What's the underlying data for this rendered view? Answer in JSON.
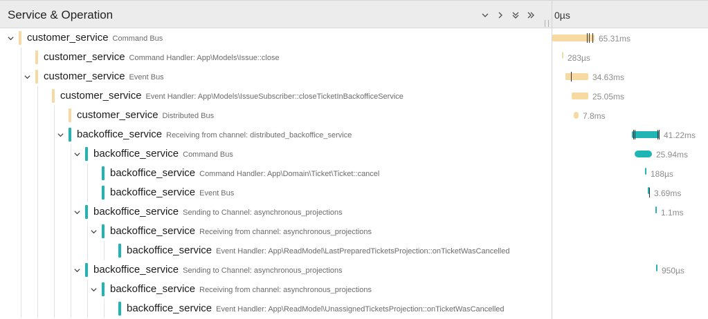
{
  "header": {
    "title": "Service & Operation",
    "timeline_start": "0µs"
  },
  "colors": {
    "customer_service": "#f7d9a2",
    "backoffice_service": "#1fb5b5"
  },
  "rows": [
    {
      "service": "customer_service",
      "operation": "Command Bus",
      "duration": "65.31ms"
    },
    {
      "service": "customer_service",
      "operation": "Command Handler: App\\Models\\Issue::close",
      "duration": "283µs"
    },
    {
      "service": "customer_service",
      "operation": "Event Bus",
      "duration": "34.63ms"
    },
    {
      "service": "customer_service",
      "operation": "Event Handler: App\\Models\\IssueSubscriber::closeTicketInBackofficeService",
      "duration": "25.05ms"
    },
    {
      "service": "customer_service",
      "operation": "Distributed Bus",
      "duration": "7.8ms"
    },
    {
      "service": "backoffice_service",
      "operation": "Receiving from channel: distributed_backoffice_service",
      "duration": "41.22ms"
    },
    {
      "service": "backoffice_service",
      "operation": "Command Bus",
      "duration": "25.94ms"
    },
    {
      "service": "backoffice_service",
      "operation": "Command Handler: App\\Domain\\Ticket\\Ticket::cancel",
      "duration": "188µs"
    },
    {
      "service": "backoffice_service",
      "operation": "Event Bus",
      "duration": "3.69ms"
    },
    {
      "service": "backoffice_service",
      "operation": "Sending to Channel: asynchronous_projections",
      "duration": "1.1ms"
    },
    {
      "service": "backoffice_service",
      "operation": "Receiving from channel: asynchronous_projections",
      "duration": ""
    },
    {
      "service": "backoffice_service",
      "operation": "Event Handler: App\\ReadModel\\LastPreparedTicketsProjection::onTicketWasCancelled",
      "duration": ""
    },
    {
      "service": "backoffice_service",
      "operation": "Sending to Channel: asynchronous_projections",
      "duration": "950µs"
    },
    {
      "service": "backoffice_service",
      "operation": "Receiving from channel: asynchronous_projections",
      "duration": ""
    },
    {
      "service": "backoffice_service",
      "operation": "Event Handler: App\\ReadModel\\UnassignedTicketsProjection::onTicketWasCancelled",
      "duration": ""
    }
  ]
}
